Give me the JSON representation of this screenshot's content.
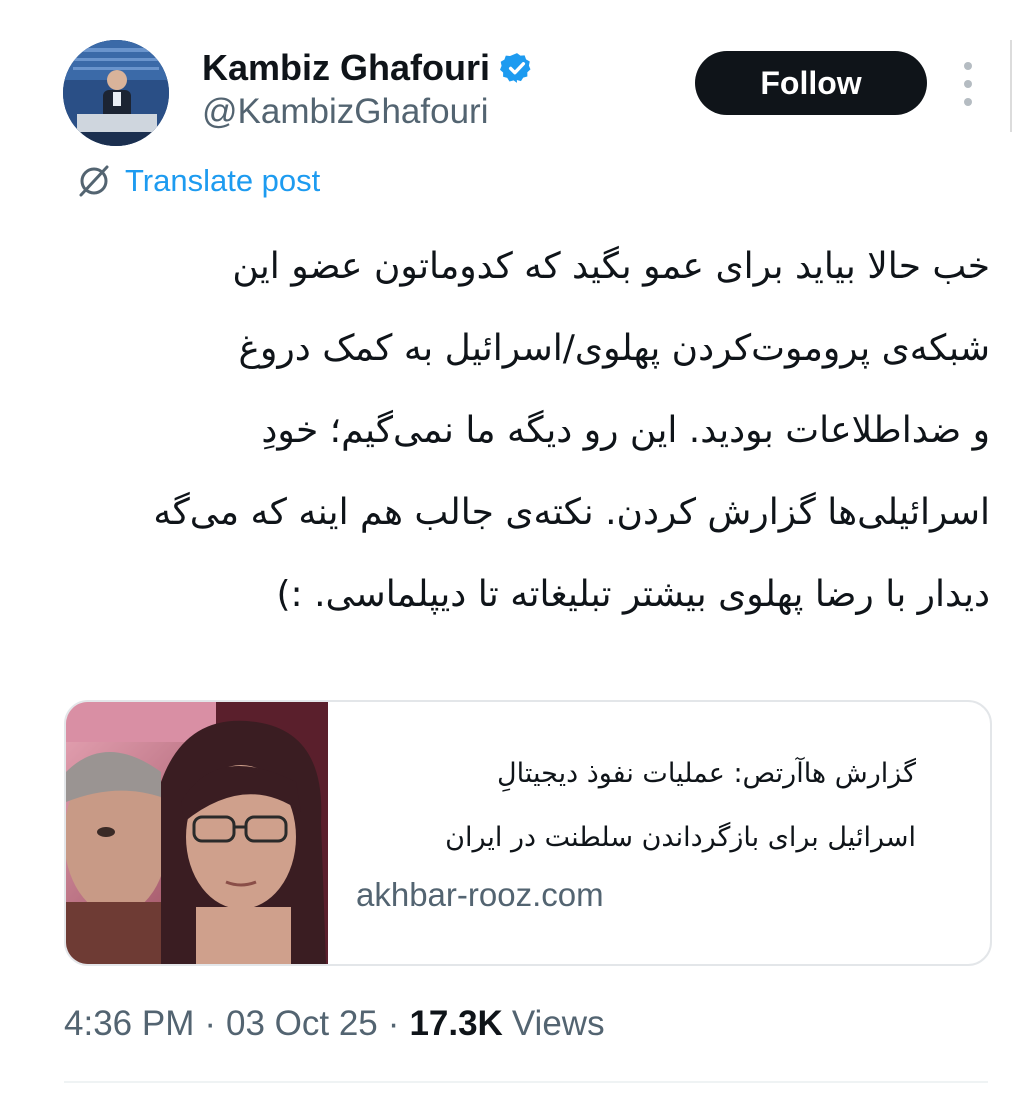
{
  "author": {
    "display_name": "Kambiz Ghafouri",
    "handle": "@KambizGhafouri",
    "verified": true
  },
  "actions": {
    "follow_label": "Follow",
    "more_icon": "more-vertical-icon"
  },
  "translate": {
    "label": "Translate post",
    "icon": "translate-icon"
  },
  "tweet": {
    "lines": [
      "خب حالا بیاید برای عمو بگید که کدوماتون عضو این",
      "شبکه‌ی پروموت‌کردن پهلوی/اسرائیل به کمک دروغ",
      "و ضداطلاعات بودید. این رو دیگه ما نمی‌گیم؛ خودِ",
      "اسرائیلی‌ها گزارش کردن. نکته‌ی جالب هم اینه که می‌گه",
      "دیدار با رضا پهلوی بیشتر تبلیغاته تا دیپلماسی. :)"
    ]
  },
  "card": {
    "title_lines": [
      "گزارش هاآرتص: عملیات نفوذ دیجیتالِ",
      "اسرائیل برای بازگرداندن سلطنت در ایران"
    ],
    "domain": "akhbar-rooz.com"
  },
  "meta": {
    "time": "4:36 PM",
    "separator": "·",
    "date": "03 Oct 25",
    "views_count": "17.3K",
    "views_label": "Views"
  },
  "colors": {
    "text": "#0f1419",
    "secondary": "#536471",
    "link": "#1d9bf0",
    "follow_bg": "#0f1419",
    "verified": "#1d9bf0"
  }
}
